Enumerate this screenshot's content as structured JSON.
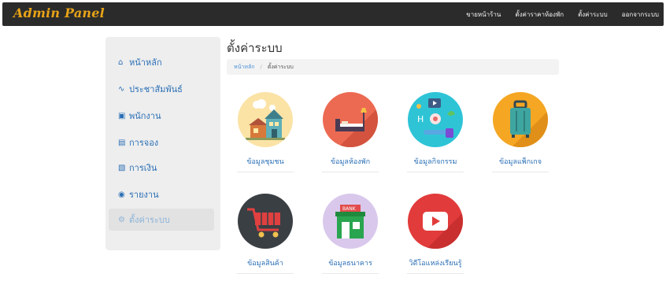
{
  "app": {
    "brand": "Admin Panel"
  },
  "nav": {
    "links": [
      "ขายหน้าร้าน",
      "ตั้งค่าราคาห้องพัก",
      "ตั้งค่าระบบ",
      "ออกจากระบบ"
    ]
  },
  "sidebar": {
    "items": [
      {
        "label": "หน้าหลัก",
        "icon": "home-icon"
      },
      {
        "label": "ประชาสัมพันธ์",
        "icon": "rss-icon"
      },
      {
        "label": "พนักงาน",
        "icon": "id-card-icon"
      },
      {
        "label": "การจอง",
        "icon": "calendar-icon"
      },
      {
        "label": "การเงิน",
        "icon": "wallet-icon"
      },
      {
        "label": "รายงาน",
        "icon": "chart-icon"
      },
      {
        "label": "ตั้งค่าระบบ",
        "icon": "gear-icon"
      }
    ]
  },
  "page": {
    "title": "ตั้งค่าระบบ",
    "breadcrumb": {
      "home": "หน้าหลัก",
      "current": "ตั้งค่าระบบ"
    }
  },
  "tiles": [
    {
      "label": "ข้อมูลชุมชน",
      "icon": "community-house-icon",
      "color": "#fbe3a6"
    },
    {
      "label": "ข้อมูลห้องพัก",
      "icon": "room-bed-icon",
      "color": "#ec6a52"
    },
    {
      "label": "ข้อมูลกิจกรรม",
      "icon": "activity-icon",
      "color": "#2ec4d6"
    },
    {
      "label": "ข้อมูลแพ็กเกจ",
      "icon": "luggage-icon",
      "color": "#f5a623"
    },
    {
      "label": "ข้อมูลสินค้า",
      "icon": "shopping-cart-icon",
      "color": "#3a3f44"
    },
    {
      "label": "ข้อมูลธนาคาร",
      "icon": "bank-icon",
      "color": "#d9c8ec"
    },
    {
      "label": "วิดีโอแหล่งเรียนรู้",
      "icon": "youtube-play-icon",
      "color": "#e23b3b"
    }
  ]
}
